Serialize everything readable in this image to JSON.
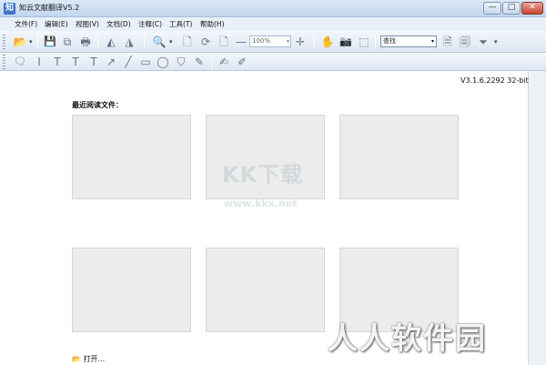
{
  "window": {
    "app_icon_text": "知",
    "title": "知云文献翻译V5.2",
    "min_glyph": "—",
    "max_glyph": "□",
    "close_glyph": "✕"
  },
  "menu": [
    "文件(F)",
    "编辑(E)",
    "视图(V)",
    "文档(D)",
    "注释(C)",
    "工具(T)",
    "帮助(H)"
  ],
  "toolbar": {
    "zoom_value": "100%",
    "search_value": "查找"
  },
  "icons": {
    "open": "📂",
    "save": "💾",
    "copy": "⧉",
    "print": "🖶",
    "rotate_left": "◭",
    "rotate_right": "◮",
    "zoom_in": "🔍",
    "fit_page": "🗋",
    "rotate_page": "⟳",
    "page": "🗋",
    "minus": "—",
    "plus": "✛",
    "hand": "✋",
    "snapshot": "📷",
    "select": "⬚",
    "doc1": "🗎",
    "doc2": "🗐",
    "filter": "⏷",
    "note": "🗨",
    "text_cursor": "Ⅰ",
    "text_t1": "T",
    "text_t2": "T",
    "text_t3": "T",
    "arrow": "↗",
    "line": "╱",
    "rect": "▭",
    "ellipse": "◯",
    "stamp": "⛉",
    "pen": "✎",
    "edit1": "✍",
    "edit2": "✐",
    "dropdown": "▾"
  },
  "main": {
    "version": "V3.1.6.2292 32-bit",
    "recent_title": "最近阅读文件：",
    "recent_files": [
      "",
      "",
      "",
      "",
      "",
      ""
    ],
    "open_label": "打开..."
  },
  "watermarks": {
    "kkx_logo": "KK下载",
    "kkx_url": "www.kkx.net",
    "rr": "人人软件园"
  }
}
